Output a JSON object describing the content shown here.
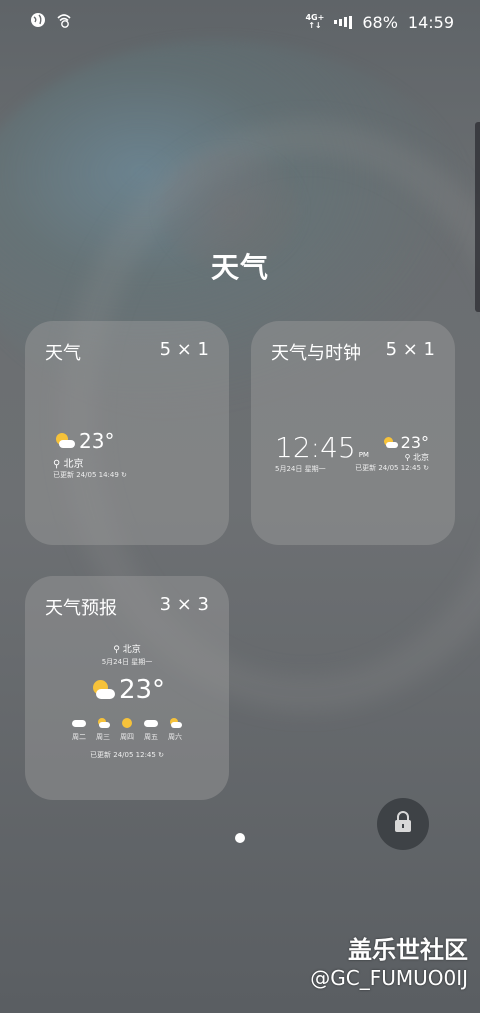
{
  "status_bar": {
    "left_icons": [
      "globe-icon",
      "wifi-calling-icon"
    ],
    "network_line1": "4G+",
    "network_line2": "↑↓",
    "battery": "68%",
    "time": "14:59"
  },
  "page": {
    "title": "天气"
  },
  "widgets": [
    {
      "name": "天气",
      "size": "5 × 1",
      "temp": "23°",
      "city": "北京",
      "updated": "已更新 24/05 14:49 ↻"
    },
    {
      "name": "天气与时钟",
      "size": "5 × 1",
      "clock": "12:45",
      "ampm": "PM",
      "date": "5月24日 星期一",
      "temp": "23°",
      "city": "北京",
      "updated": "已更新 24/05 12:45 ↻"
    },
    {
      "name": "天气预报",
      "size": "3 × 3",
      "city": "北京",
      "date": "5月24日 星期一",
      "temp": "23°",
      "forecast": [
        "周二",
        "周三",
        "周四",
        "周五",
        "周六"
      ],
      "updated": "已更新 24/05 12:45 ↻"
    }
  ],
  "page_indicator": {
    "pages": 1,
    "current": 1
  },
  "lock_button": {
    "icon": "lock-icon"
  },
  "watermark": {
    "brand": "盖乐世社区",
    "user": "@GC_FUMUO0IJ"
  },
  "colors": {
    "sun": "#f6c23a",
    "card_bg": "rgba(160,160,160,0.42)",
    "lock_bg": "#3e4246"
  }
}
